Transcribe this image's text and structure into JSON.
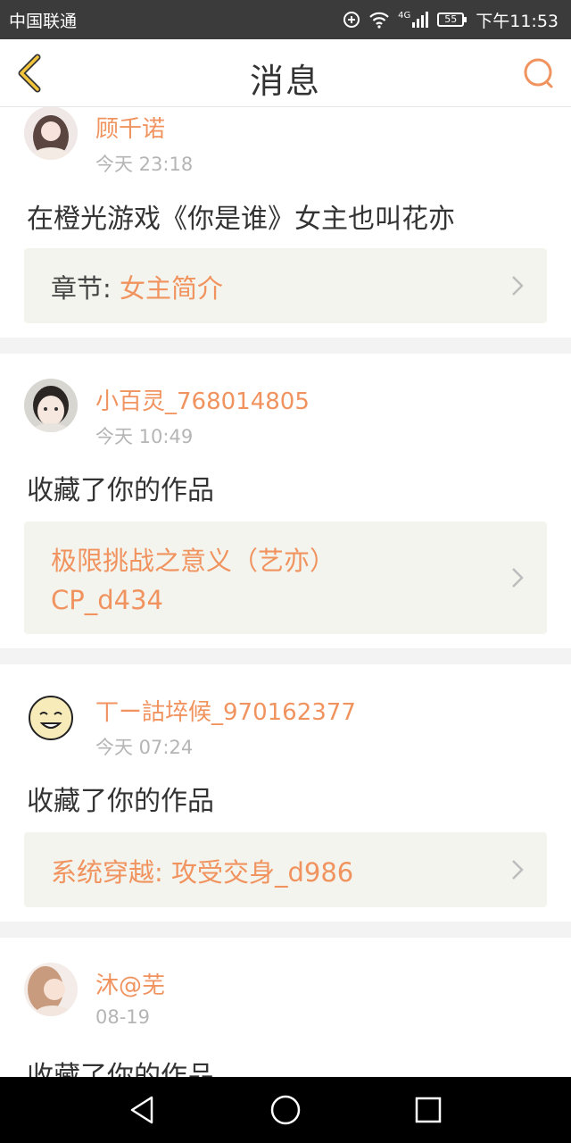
{
  "status": {
    "carrier": "中国联通",
    "network": "4G",
    "battery": "55",
    "time": "下午11:53"
  },
  "header": {
    "title": "消息",
    "back_icon": "chevron-left-icon",
    "search_icon": "search-icon"
  },
  "colors": {
    "accent": "#f0935f",
    "ref_bg": "#f4f4ee",
    "separator": "#f3f3f3"
  },
  "messages": [
    {
      "name": "顾千诺",
      "time": "今天  23:18",
      "text": "在橙光游戏《你是谁》女主也叫花亦",
      "ref_prefix": "章节:",
      "ref_lines": [
        "女主简介"
      ]
    },
    {
      "name": "小百灵_768014805",
      "time": "今天  10:49",
      "text": "收藏了你的作品",
      "ref_prefix": "",
      "ref_lines": [
        "极限挑战之意义（艺亦）",
        "CP_d434"
      ]
    },
    {
      "name": "丅ー詁埣候_970162377",
      "time": "今天  07:24",
      "text": "收藏了你的作品",
      "ref_prefix": "",
      "ref_lines": [
        "系统穿越: 攻受交身_d986"
      ]
    },
    {
      "name": "沐@芜",
      "time": "08-19",
      "text": "收藏了你的作品"
    }
  ]
}
